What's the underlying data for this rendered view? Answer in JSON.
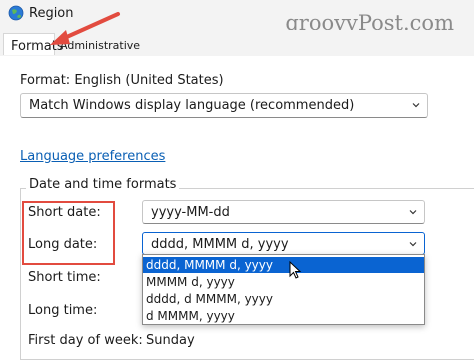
{
  "window": {
    "title": "Region",
    "icon": "globe-icon"
  },
  "watermark": "groovyPost.com",
  "tabs": [
    {
      "label": "Formats",
      "active": true
    },
    {
      "label": "Administrative",
      "active": false
    }
  ],
  "format": {
    "label": "Format: English (United States)",
    "value": "Match Windows display language (recommended)"
  },
  "language_preferences_link": "Language preferences",
  "date_time": {
    "group_title": "Date and time formats",
    "short_date_label": "Short date:",
    "short_date_value": "yyyy-MM-dd",
    "long_date_label": "Long date:",
    "long_date_value": "dddd, MMMM d, yyyy",
    "short_time_label": "Short time:",
    "long_time_label": "Long time:",
    "first_day_label": "First day of week:",
    "first_day_value": "Sunday"
  },
  "long_date_options": [
    "dddd, MMMM d, yyyy",
    "MMMM d, yyyy",
    "dddd, d MMMM, yyyy",
    "d MMMM, yyyy"
  ],
  "colors": {
    "accent": "#0a64d2",
    "annotation": "#e24b3f",
    "link": "#0a5fb4"
  }
}
